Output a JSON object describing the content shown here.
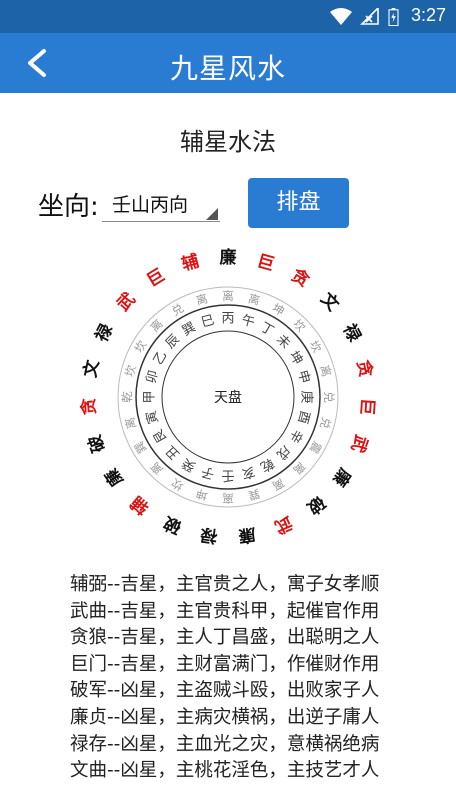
{
  "status": {
    "time": "3:27"
  },
  "header": {
    "title": "九星风水"
  },
  "page": {
    "subtitle": "辅星水法"
  },
  "form": {
    "sitting_label": "坐向:",
    "sitting_value": "壬山丙向",
    "button_label": "排盘"
  },
  "wheel": {
    "center_label": "天盘",
    "outer": [
      {
        "t": "廉",
        "c": "#111"
      },
      {
        "t": "巨",
        "c": "#d11"
      },
      {
        "t": "贪",
        "c": "#d11"
      },
      {
        "t": "文",
        "c": "#111"
      },
      {
        "t": "禄",
        "c": "#111"
      },
      {
        "t": "贪",
        "c": "#d11"
      },
      {
        "t": "巨",
        "c": "#d11"
      },
      {
        "t": "武",
        "c": "#d11"
      },
      {
        "t": "廉",
        "c": "#111"
      },
      {
        "t": "破",
        "c": "#111"
      },
      {
        "t": "武",
        "c": "#d11"
      },
      {
        "t": "廉",
        "c": "#111"
      },
      {
        "t": "禄",
        "c": "#111"
      },
      {
        "t": "破",
        "c": "#111"
      },
      {
        "t": "辅",
        "c": "#d11"
      },
      {
        "t": "廉",
        "c": "#111"
      },
      {
        "t": "破",
        "c": "#111"
      },
      {
        "t": "贪",
        "c": "#d11"
      },
      {
        "t": "文",
        "c": "#111"
      },
      {
        "t": "禄",
        "c": "#111"
      },
      {
        "t": "武",
        "c": "#d11"
      },
      {
        "t": "巨",
        "c": "#d11"
      },
      {
        "t": "辅",
        "c": "#d11"
      }
    ],
    "ring2": [
      {
        "t": "离",
        "c": "#999"
      },
      {
        "t": "离",
        "c": "#999"
      },
      {
        "t": "坤",
        "c": "#999"
      },
      {
        "t": "坎",
        "c": "#999"
      },
      {
        "t": "坎",
        "c": "#999"
      },
      {
        "t": "离",
        "c": "#999"
      },
      {
        "t": "兑",
        "c": "#999"
      },
      {
        "t": "兑",
        "c": "#999"
      },
      {
        "t": "震",
        "c": "#999"
      },
      {
        "t": "离",
        "c": "#999"
      },
      {
        "t": "离",
        "c": "#999"
      },
      {
        "t": "巽",
        "c": "#999"
      },
      {
        "t": "离",
        "c": "#999"
      },
      {
        "t": "坤",
        "c": "#999"
      },
      {
        "t": "坎",
        "c": "#999"
      },
      {
        "t": "离",
        "c": "#999"
      },
      {
        "t": "巽",
        "c": "#999"
      },
      {
        "t": "离",
        "c": "#999"
      },
      {
        "t": "乾",
        "c": "#999"
      },
      {
        "t": "坎",
        "c": "#999"
      },
      {
        "t": "坎",
        "c": "#999"
      },
      {
        "t": "离",
        "c": "#999"
      },
      {
        "t": "兑",
        "c": "#999"
      },
      {
        "t": "离",
        "c": "#999"
      }
    ],
    "ring3": [
      "丙",
      "午",
      "丁",
      "未",
      "坤",
      "申",
      "庚",
      "酉",
      "辛",
      "戌",
      "乾",
      "亥",
      "壬",
      "子",
      "癸",
      "丑",
      "艮",
      "寅",
      "甲",
      "卯",
      "乙",
      "辰",
      "巽",
      "巳"
    ]
  },
  "descriptions": [
    "辅弼--吉星，主官贵之人，寓子女孝顺",
    "武曲--吉星，主官贵科甲，起催官作用",
    "贪狼--吉星，主人丁昌盛，出聪明之人",
    "巨门--吉星，主财富满门，作催财作用",
    "破军--凶星，主盗贼斗殴，出败家子人",
    "廉贞--凶星，主病灾横祸，出逆子庸人",
    "禄存--凶星，主血光之灾，意横祸绝病",
    "文曲--凶星，主桃花淫色，主技艺才人"
  ]
}
